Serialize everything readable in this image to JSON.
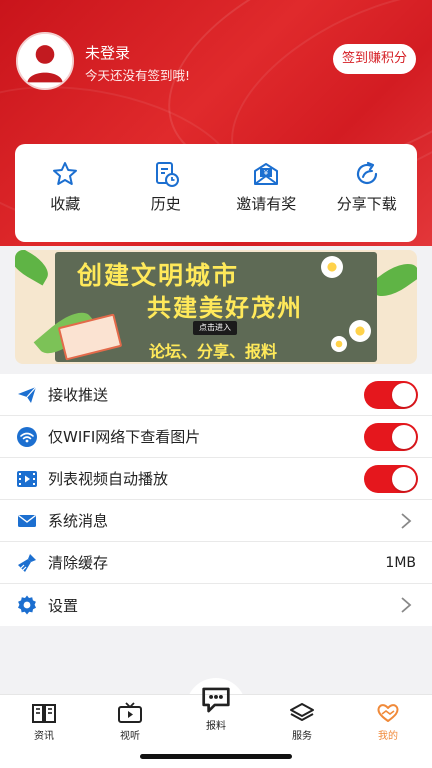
{
  "profile": {
    "name": "未登录",
    "subtitle": "今天还没有签到哦!",
    "signin_label": "签到赚积分"
  },
  "quick_actions": [
    {
      "label": "收藏",
      "icon": "star-icon"
    },
    {
      "label": "历史",
      "icon": "history-icon"
    },
    {
      "label": "邀请有奖",
      "icon": "invite-icon"
    },
    {
      "label": "分享下载",
      "icon": "share-icon"
    }
  ],
  "banner": {
    "line1": "创建文明城市",
    "line2": "共建美好茂州",
    "enter": "点击进入",
    "line3": "论坛、分享、报料"
  },
  "settings": [
    {
      "label": "接收推送",
      "icon": "paper-plane-icon",
      "control": "toggle",
      "on": true
    },
    {
      "label": "仅WIFI网络下查看图片",
      "icon": "wifi-icon",
      "control": "toggle",
      "on": true
    },
    {
      "label": "列表视频自动播放",
      "icon": "video-icon",
      "control": "toggle",
      "on": true
    },
    {
      "label": "系统消息",
      "icon": "mail-icon",
      "control": "chevron"
    },
    {
      "label": "清除缓存",
      "icon": "broom-icon",
      "control": "value",
      "value": "1MB"
    },
    {
      "label": "设置",
      "icon": "gear-icon",
      "control": "chevron"
    }
  ],
  "tabs": [
    {
      "label": "资讯",
      "icon": "news-icon"
    },
    {
      "label": "视听",
      "icon": "tv-icon"
    },
    {
      "label": "报料",
      "icon": "chat-icon"
    },
    {
      "label": "服务",
      "icon": "layers-icon"
    },
    {
      "label": "我的",
      "icon": "heart-hands-icon",
      "active": true
    }
  ],
  "colors": {
    "brand_red": "#d51e24",
    "toggle_on": "#e5171d",
    "active_tab": "#f08a3a"
  }
}
